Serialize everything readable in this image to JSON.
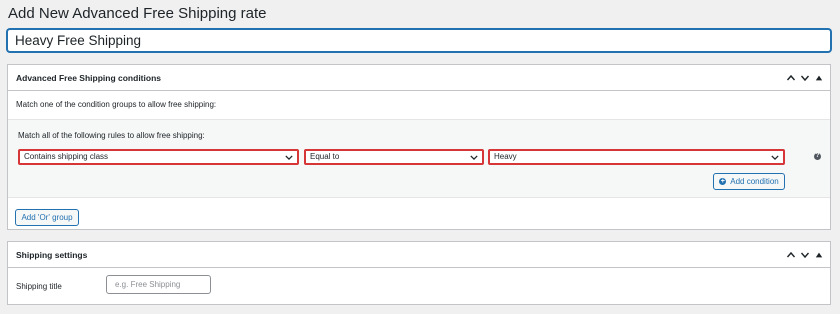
{
  "page": {
    "title": "Add New Advanced Free Shipping rate"
  },
  "rate_title": {
    "value": "Heavy Free Shipping"
  },
  "conditions_box": {
    "title": "Advanced Free Shipping conditions",
    "intro": "Match one of the condition groups to allow free shipping:",
    "group": {
      "label": "Match all of the following rules to allow free shipping:",
      "condition_select": "Contains shipping class",
      "operator_select": "Equal to",
      "value_select": "Heavy",
      "add_condition_label": "Add condition"
    },
    "add_or_group_label": "Add 'Or' group"
  },
  "shipping_box": {
    "title": "Shipping settings",
    "shipping_title_label": "Shipping title",
    "shipping_title_placeholder": "e.g. Free Shipping"
  },
  "colors": {
    "accent": "#2271b1",
    "highlight_border": "#d63638",
    "background": "#f0f0f1"
  }
}
